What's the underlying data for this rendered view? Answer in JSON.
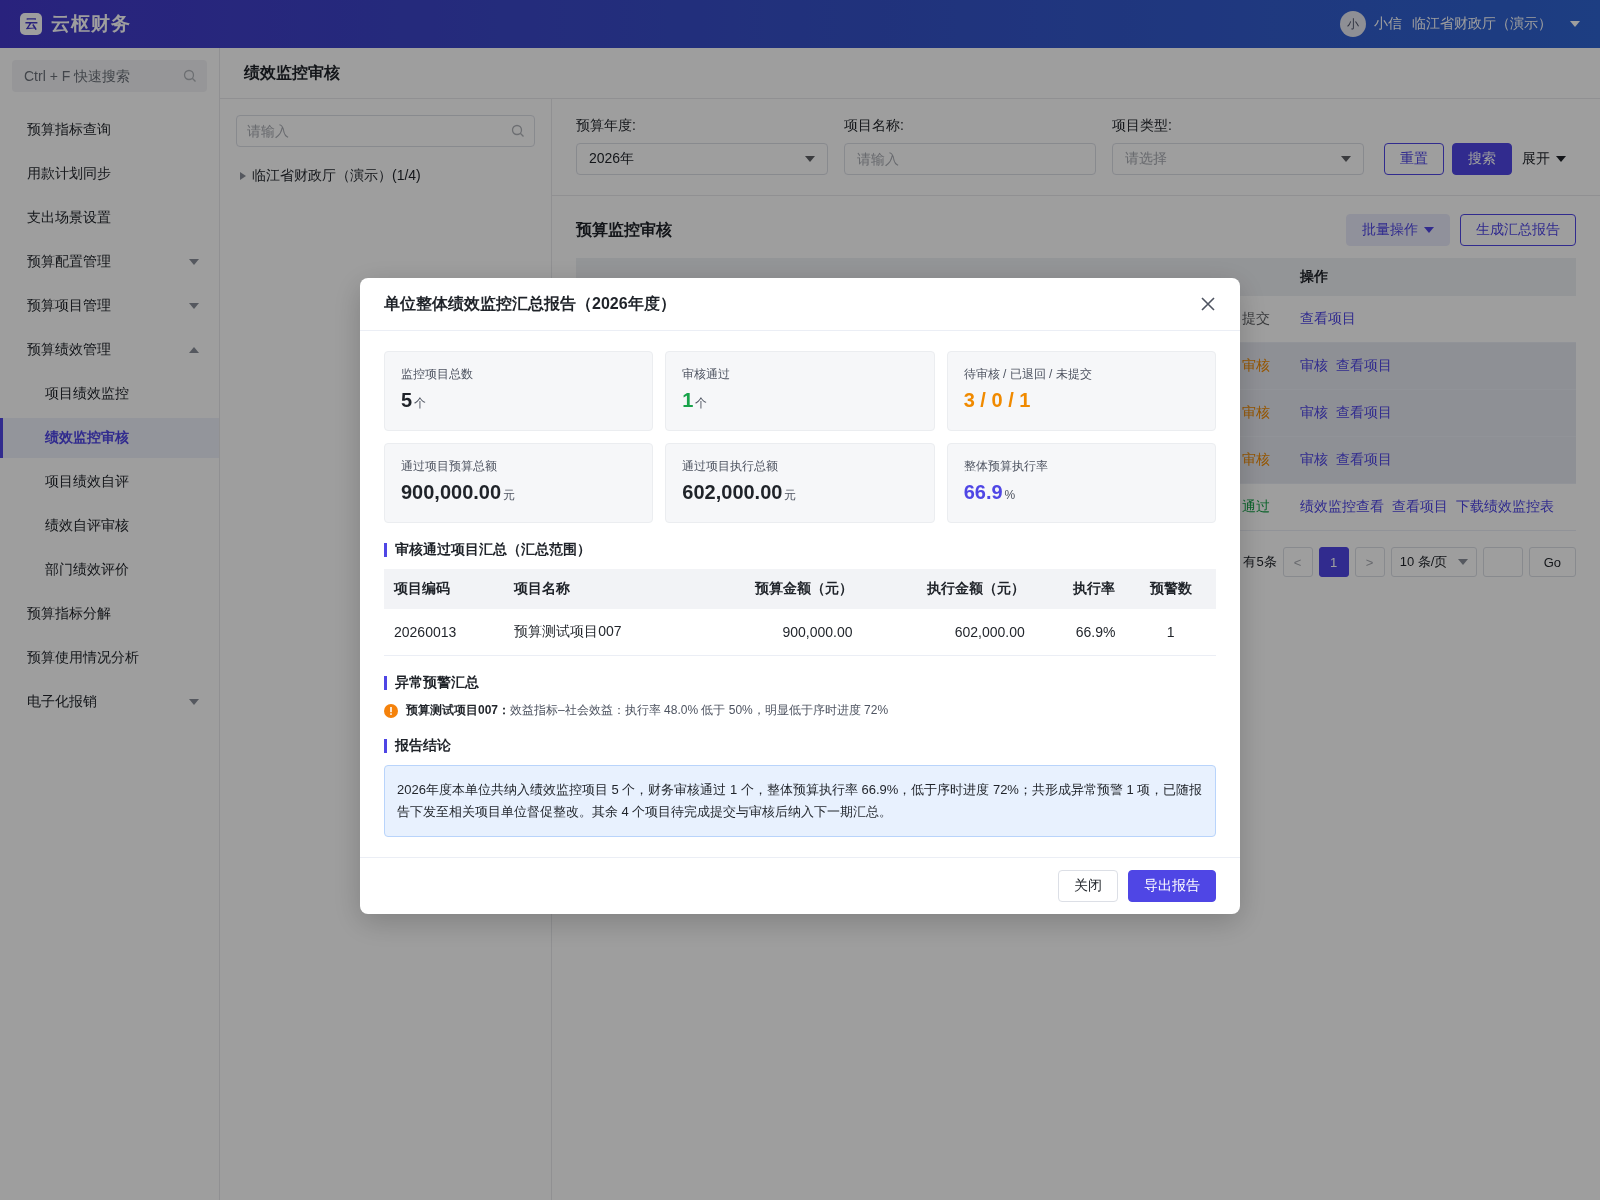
{
  "header": {
    "logo_mark": "云",
    "app_name": "云枢财务",
    "avatar": "小",
    "user_name": "小信",
    "org": "临江省财政厅（演示）"
  },
  "sidebar": {
    "search_placeholder": "Ctrl + F 快速搜索",
    "items": [
      {
        "label": "预算指标查询",
        "kind": "link",
        "selected": false
      },
      {
        "label": "用款计划同步",
        "kind": "link",
        "selected": false
      },
      {
        "label": "支出场景设置",
        "kind": "link",
        "selected": false
      },
      {
        "label": "预算配置管理",
        "kind": "group",
        "expanded": false,
        "selected": false
      },
      {
        "label": "预算项目管理",
        "kind": "group",
        "expanded": false,
        "selected": false
      },
      {
        "label": "预算绩效管理",
        "kind": "group",
        "expanded": true,
        "selected": false,
        "children": [
          {
            "label": "项目绩效监控",
            "kind": "link",
            "selected": false
          },
          {
            "label": "绩效监控审核",
            "kind": "link",
            "selected": true
          },
          {
            "label": "项目绩效自评",
            "kind": "link",
            "selected": false
          },
          {
            "label": "绩效自评审核",
            "kind": "link",
            "selected": false
          },
          {
            "label": "部门绩效评价",
            "kind": "link",
            "selected": false
          }
        ]
      },
      {
        "label": "预算指标分解",
        "kind": "link",
        "selected": false
      },
      {
        "label": "预算使用情况分析",
        "kind": "link",
        "selected": false
      },
      {
        "label": "电子化报销",
        "kind": "group",
        "expanded": false,
        "selected": false
      }
    ]
  },
  "page_title": "绩效监控审核",
  "tree": {
    "search_placeholder": "请输入",
    "nodes": [
      {
        "label": "临江省财政厅（演示）(1/4)",
        "expanded": false
      }
    ]
  },
  "filters": {
    "fields": [
      {
        "label": "预算年度:",
        "kind": "select",
        "value": "2026年"
      },
      {
        "label": "项目名称:",
        "kind": "input",
        "placeholder": "请输入"
      },
      {
        "label": "项目类型:",
        "kind": "select",
        "placeholder": "请选择"
      }
    ],
    "buttons": [
      {
        "label": "重置",
        "kind": "outline"
      },
      {
        "label": "搜索",
        "kind": "primary"
      }
    ],
    "expand_toggle": "展开"
  },
  "table_card": {
    "title": "预算监控审核",
    "buttons": [
      {
        "label": "批量操作",
        "kind": "dropdown"
      },
      {
        "label": "生成汇总报告",
        "kind": "outline"
      }
    ],
    "visible_header": "操作",
    "rows": [
      {
        "status": "提交",
        "kind": "draft",
        "highlighted": false,
        "actions": [
          "查看项目"
        ]
      },
      {
        "status": "审核",
        "kind": "pending",
        "highlighted": true,
        "actions": [
          "审核",
          "查看项目"
        ]
      },
      {
        "status": "审核",
        "kind": "pending",
        "highlighted": true,
        "actions": [
          "审核",
          "查看项目"
        ]
      },
      {
        "status": "审核",
        "kind": "pending",
        "highlighted": true,
        "actions": [
          "审核",
          "查看项目"
        ]
      },
      {
        "status": "通过",
        "kind": "approved",
        "highlighted": false,
        "actions": [
          "绩效监控查看",
          "查看项目",
          "下载绩效监控表"
        ]
      }
    ],
    "pagination": {
      "total": "有5条",
      "prev": "<",
      "pages": [
        {
          "label": "1",
          "selected": true
        }
      ],
      "next": ">",
      "page_size": "10 条/页",
      "go": "Go"
    }
  },
  "modal": {
    "title": "单位整体绩效监控汇总报告（2026年度）",
    "stats": [
      {
        "label": "监控项目总数",
        "value": "5",
        "unit": "个",
        "color": "#1f2329"
      },
      {
        "label": "审核通过",
        "value": "1",
        "unit": "个",
        "color": "#18a34a"
      },
      {
        "label": "待审核 / 已退回 / 未提交",
        "value": "3 / 0 / 1",
        "color": "#f08a00"
      },
      {
        "label": "通过项目预算总额",
        "value": "900,000.00",
        "unit": "元",
        "color": "#1f2329"
      },
      {
        "label": "通过项目执行总额",
        "value": "602,000.00",
        "unit": "元",
        "color": "#1f2329"
      },
      {
        "label": "整体预算执行率",
        "value": "66.9",
        "unit": "%",
        "color": "#4f46e5"
      }
    ],
    "summary_title": "审核通过项目汇总（汇总范围）",
    "summary_table": {
      "columns": [
        "项目编码",
        "项目名称",
        "预算金额（元）",
        "执行金额（元）",
        "执行率",
        "预警数"
      ],
      "rows": [
        [
          "20260013",
          "预算测试项目007",
          "900,000.00",
          "602,000.00",
          "66.9%",
          "1"
        ]
      ]
    },
    "warnings_title": "异常预警汇总",
    "warnings": [
      "**预算测试项目007：**效益指标–社会效益：执行率 48.0% 低于 50%，明显低于序时进度 72%"
    ],
    "conclusion_title": "报告结论",
    "conclusion": "2026年度本单位共纳入绩效监控项目 5 个，财务审核通过 1 个，整体预算执行率 66.9%，低于序时进度 72%；共形成异常预警 1 项，已随报告下发至相关项目单位督促整改。其余 4 个项目待完成提交与审核后纳入下一期汇总。",
    "buttons": [
      {
        "label": "关闭",
        "kind": "default"
      },
      {
        "label": "导出报告",
        "kind": "primary"
      }
    ]
  }
}
